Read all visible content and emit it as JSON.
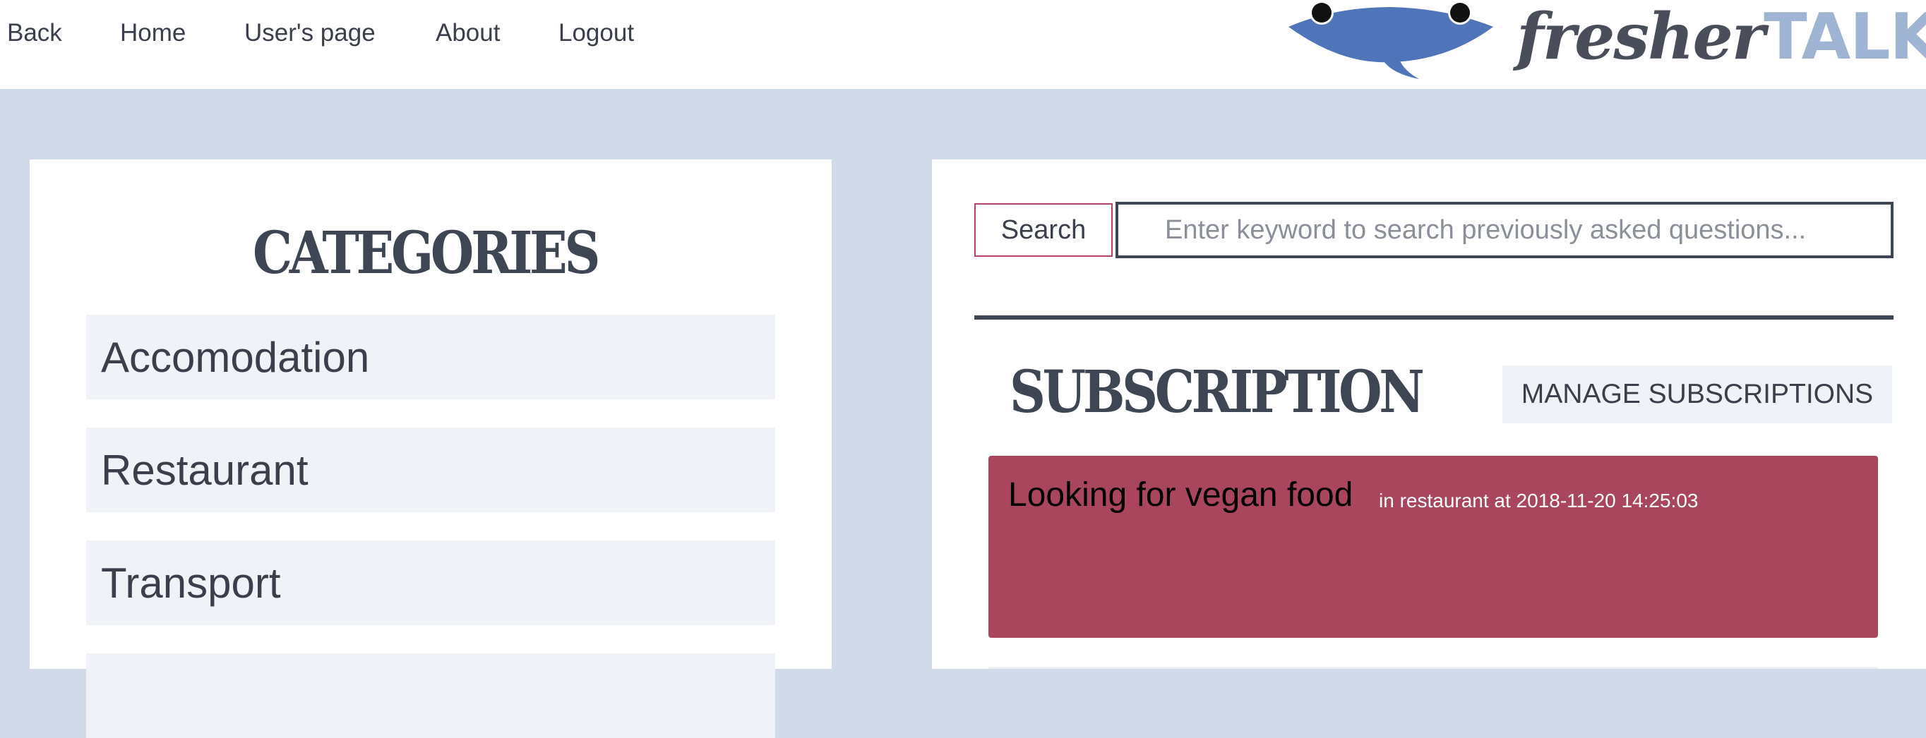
{
  "nav": {
    "links": [
      "Back",
      "Home",
      "User's page",
      "About",
      "Logout"
    ]
  },
  "logo": {
    "part1": "fresher",
    "part2": "TALK",
    "icon": "fish-mascot-icon"
  },
  "categories": {
    "title": "CATEGORIES",
    "items": [
      "Accomodation",
      "Restaurant",
      "Transport",
      ""
    ]
  },
  "search": {
    "button_label": "Search",
    "placeholder": "Enter keyword to search previously asked questions..."
  },
  "subscription": {
    "title": "SUBSCRIPTION",
    "manage_label": "MANAGE SUBSCRIPTIONS",
    "items": [
      {
        "title": "Looking for vegan food",
        "meta": "in restaurant at 2018-11-20 14:25:03"
      }
    ]
  },
  "colors": {
    "background": "#d0dae9",
    "accent": "#a9465e",
    "logo_blue": "#4f74b9",
    "logo_light": "#9fb3d3",
    "heading": "#3e4553"
  }
}
